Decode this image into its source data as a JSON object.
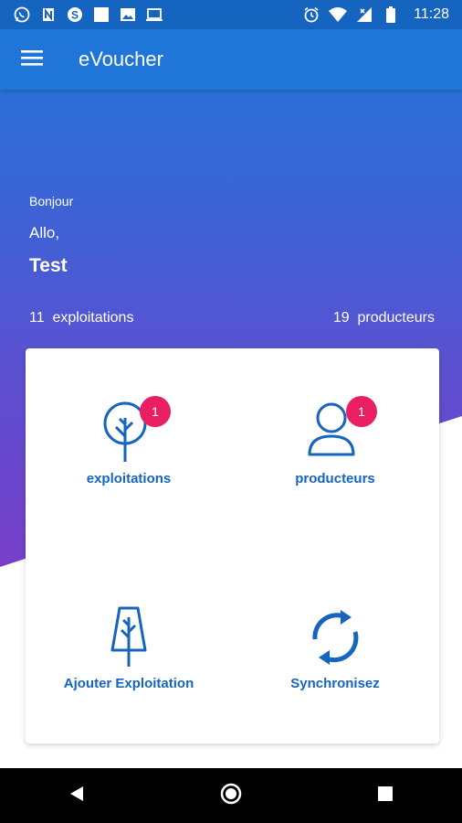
{
  "status_bar": {
    "time": "11:28",
    "left_icons": [
      "whatsapp-icon",
      "n-icon",
      "skype-icon",
      "square-icon",
      "image-icon",
      "laptop-icon"
    ],
    "right_icons": [
      "alarm-icon",
      "wifi-icon",
      "signal-icon",
      "battery-icon"
    ]
  },
  "app_bar": {
    "title": "eVoucher",
    "menu_icon": "menu-icon"
  },
  "greeting": {
    "small": "Bonjour",
    "allo": "Allo,",
    "name": "Test"
  },
  "counts": {
    "exploitations": "11  exploitations",
    "producteurs": "19  producteurs"
  },
  "tiles": [
    {
      "label": "exploitations",
      "icon": "tree-icon",
      "badge": "1"
    },
    {
      "label": "producteurs",
      "icon": "user-icon",
      "badge": "1"
    },
    {
      "label": "Ajouter Exploitation",
      "icon": "add-tree-icon"
    },
    {
      "label": "Synchronisez",
      "icon": "sync-icon"
    }
  ],
  "colors": {
    "primary": "#1f76d8",
    "status_bar": "#1565c0",
    "gradient_end": "#7a3dc8",
    "accent_text": "#1565c0",
    "badge": "#e91e63"
  },
  "nav_bar": [
    "back-icon",
    "home-icon",
    "recents-icon"
  ]
}
